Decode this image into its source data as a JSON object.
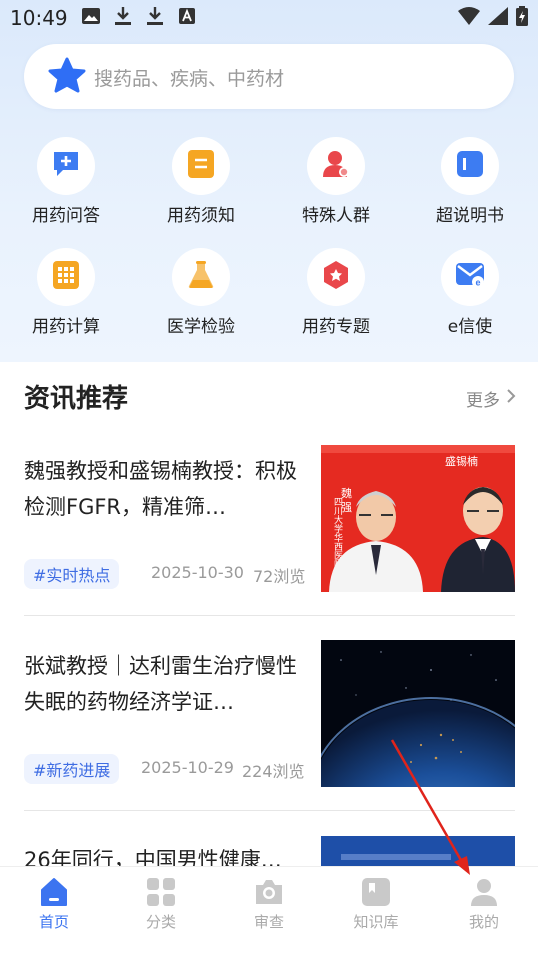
{
  "status_bar": {
    "time": "10:49"
  },
  "search": {
    "placeholder": "搜药品、疾病、中药材"
  },
  "quick_grid": [
    {
      "label": "用药问答",
      "icon": "chat-plus-icon",
      "color": "#3d7cf2"
    },
    {
      "label": "用药须知",
      "icon": "notice-icon",
      "color": "#f5a623"
    },
    {
      "label": "特殊人群",
      "icon": "person-icon",
      "color": "#e9474b"
    },
    {
      "label": "超说明书",
      "icon": "book-icon",
      "color": "#3d7cf2"
    },
    {
      "label": "用药计算",
      "icon": "calculator-icon",
      "color": "#f5a623"
    },
    {
      "label": "医学检验",
      "icon": "flask-icon",
      "color": "#f5a623"
    },
    {
      "label": "用药专题",
      "icon": "badge-icon",
      "color": "#e9474b"
    },
    {
      "label": "e信使",
      "icon": "mail-icon",
      "color": "#3d7cf2"
    }
  ],
  "news_section": {
    "title": "资讯推荐",
    "more": "更多"
  },
  "news": [
    {
      "title": "魏强教授和盛锡楠教授：积极检测FGFR，精准筛…",
      "tag": "#实时热点",
      "date": "2025-10-30",
      "views": "72浏览",
      "thumb_names": [
        "魏",
        "强",
        "盛锡楠"
      ]
    },
    {
      "title": "张斌教授｜达利雷生治疗慢性失眠的药物经济学证…",
      "tag": "#新药进展",
      "date": "2025-10-29",
      "views": "224浏览"
    },
    {
      "title": "26年同行，中国男性健康…"
    }
  ],
  "tabs": [
    {
      "label": "首页",
      "icon": "home-icon",
      "active": true
    },
    {
      "label": "分类",
      "icon": "grid-icon",
      "active": false
    },
    {
      "label": "审查",
      "icon": "camera-icon",
      "active": false
    },
    {
      "label": "知识库",
      "icon": "bookmark-icon",
      "active": false
    },
    {
      "label": "我的",
      "icon": "user-icon",
      "active": false
    }
  ],
  "colors": {
    "accent": "#3c74f0",
    "tag_bg": "#eef3fe",
    "annotation_arrow": "#e0241b"
  }
}
